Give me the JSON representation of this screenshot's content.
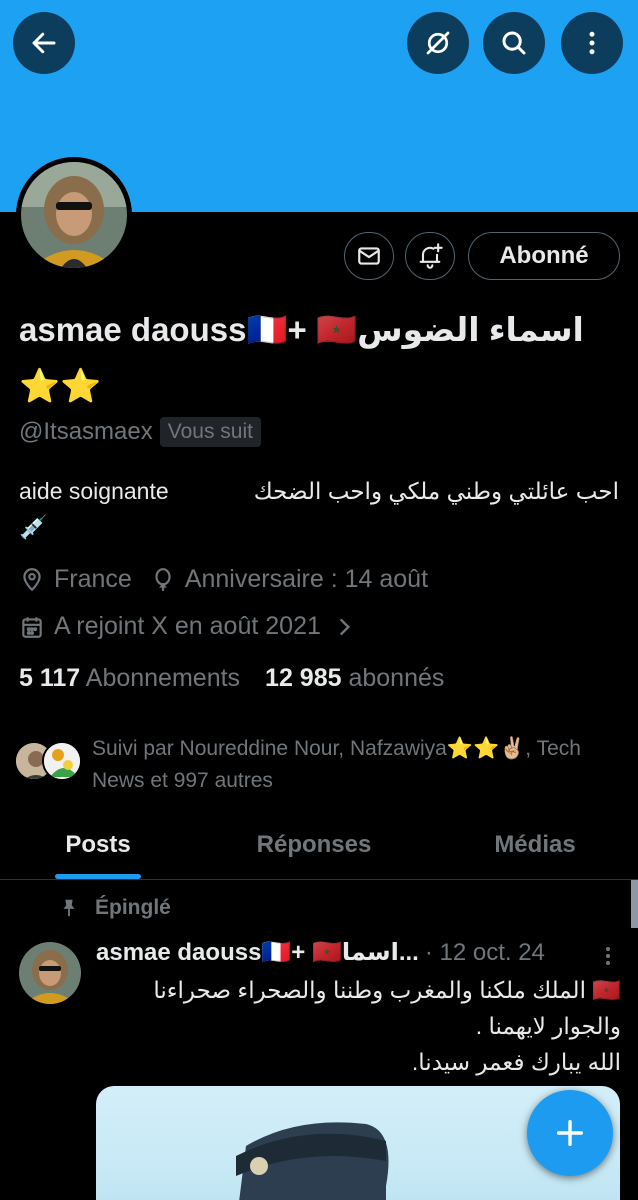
{
  "header": {
    "back_icon": "arrow-left-icon",
    "nosync_icon": "slashed-circle-icon",
    "search_icon": "search-icon",
    "more_icon": "vertical-dots-icon",
    "banner_color": "#1da1f2"
  },
  "profile": {
    "display_name": "asmae daouss🇫🇷+ 🇲🇦اسماء الضوس ⭐⭐",
    "handle": "@Itsasmaex",
    "follows_you_badge": "Vous suit",
    "bio_fr": "aide soignante",
    "bio_ar": "احب عائلتي وطني ملكي واحب الضحك",
    "bio_emoji": "💉",
    "location": "France",
    "birthday": "Anniversaire : 14 août",
    "joined": "A rejoint X en août 2021",
    "following_count": "5 117",
    "following_label": "Abonnements",
    "followers_count": "12 985",
    "followers_label": "abonnés",
    "followed_by": "Suivi par Noureddine Nour, Nafzawiya⭐⭐✌🏼, Tech News et 997 autres"
  },
  "actions": {
    "mail_icon": "mail-icon",
    "notif_icon": "bell-plus-icon",
    "follow_label": "Abonné"
  },
  "tabs": [
    {
      "label": "Posts",
      "active": true
    },
    {
      "label": "Réponses",
      "active": false
    },
    {
      "label": "Médias",
      "active": false
    }
  ],
  "pinned_post": {
    "pinned_label": "Épinglé",
    "author": "asmae daouss🇫🇷+ 🇲🇦اسما...",
    "date": "· 12 oct. 24",
    "text": "🇲🇦 الملك ملكنا والمغرب وطننا والصحراء صحراءنا والجوار لايهمنا .\nالله يبارك فعمر سيدنا."
  },
  "fab": {
    "icon": "plus-icon",
    "color": "#1d9bf0"
  },
  "accent": "#1d9bf0"
}
